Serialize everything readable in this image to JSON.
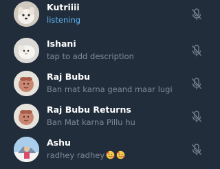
{
  "participants": [
    {
      "name": "Kutriiii",
      "subtitle": "listening",
      "status": "speaking",
      "mic_icon": "muted-mic-icon"
    },
    {
      "name": "Ishani",
      "subtitle": "tap to add description",
      "status": "idle",
      "mic_icon": "muted-mic-icon"
    },
    {
      "name": "Raj Bubu",
      "subtitle": "Ban mat karna geand maar lugi",
      "status": "idle",
      "mic_icon": "muted-mic-icon"
    },
    {
      "name": "Raj Bubu Returns",
      "subtitle": "Ban Mat karna Pillu hu",
      "status": "idle",
      "mic_icon": "muted-mic-icon"
    },
    {
      "name": "Ashu",
      "subtitle": "radhey radhey",
      "status": "idle",
      "mic_icon": "muted-mic-icon",
      "emoji": "smiling-face-with-hearts-emoji x2"
    }
  ],
  "colors": {
    "background": "#212d3b",
    "name_text": "#ffffff",
    "subtitle_text": "#7d8b99",
    "active_subtitle": "#5eb5f7",
    "mic_icon": "#6f7c89"
  }
}
